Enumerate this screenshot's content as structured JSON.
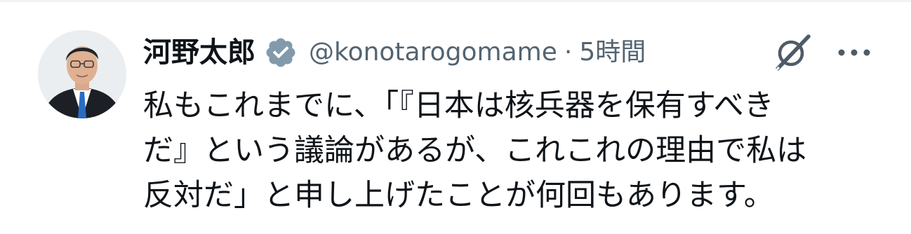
{
  "tweet": {
    "author": {
      "display_name": "河野太郎",
      "handle": "@konotarogomame",
      "verified_icon": "verified-badge-icon",
      "verified_color": "#829aab",
      "avatar_icon": "profile-photo"
    },
    "separator": "·",
    "timestamp": "5時間",
    "actions": {
      "grok_icon": "grok-icon",
      "more_icon": "more-horizontal-icon"
    },
    "text_lines": [
      "私もこれまでに、「『日本は核兵器を保有すべき",
      "だ』という議論があるが、これこれの理由で私は",
      "反対だ」と申し上げたことが何回もあります。"
    ]
  },
  "colors": {
    "primary_text": "#0f1419",
    "secondary_text": "#536471",
    "background": "#ffffff"
  }
}
